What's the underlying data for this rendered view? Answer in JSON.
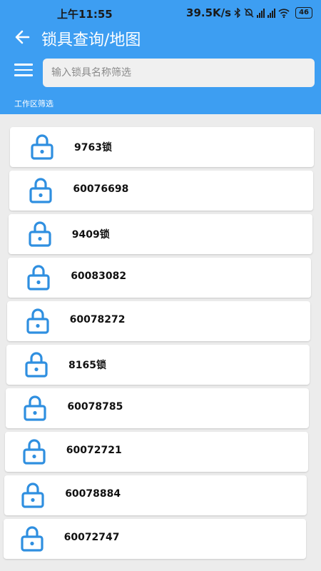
{
  "status_bar": {
    "time": "上午11:55",
    "network_speed": "39.5K/s",
    "battery": "46"
  },
  "header": {
    "title": "锁具查询/地图",
    "search_placeholder": "输入锁具名称筛选",
    "filter_label": "工作区筛选"
  },
  "locks": [
    {
      "name": "9763锁"
    },
    {
      "name": "60076698"
    },
    {
      "name": "9409锁"
    },
    {
      "name": "60083082"
    },
    {
      "name": "60078272"
    },
    {
      "name": "8165锁"
    },
    {
      "name": "60078785"
    },
    {
      "name": "60072721"
    },
    {
      "name": "60078884"
    },
    {
      "name": "60072747"
    }
  ],
  "colors": {
    "primary": "#3d9ef2",
    "lock_icon": "#2f8fe0",
    "background": "#ececec",
    "card": "#ffffff"
  }
}
